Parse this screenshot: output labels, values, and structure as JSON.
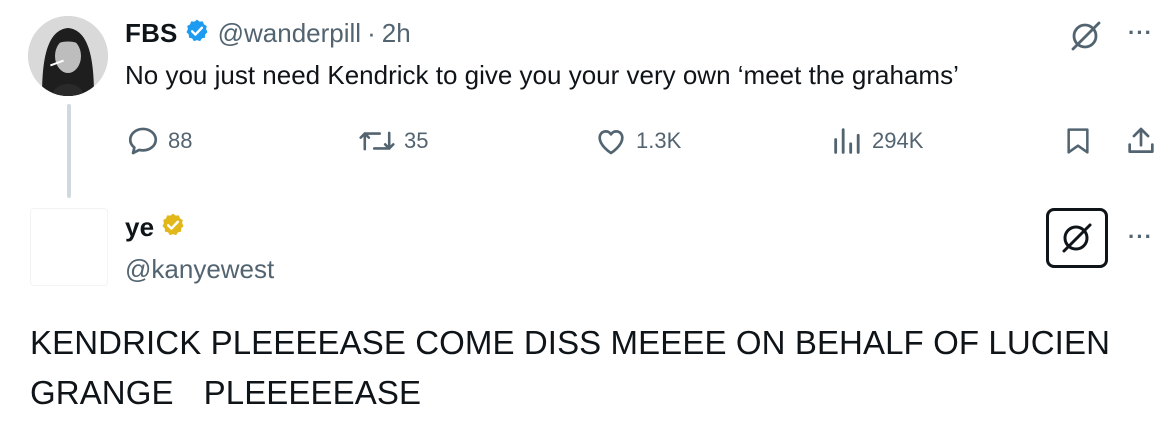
{
  "tweet1": {
    "display_name": "FBS",
    "handle": "@wanderpill",
    "separator": "·",
    "time": "2h",
    "text": "No you just need Kendrick to give you your very own ‘meet the grahams’",
    "stats": {
      "replies": "88",
      "reposts": "35",
      "likes": "1.3K",
      "views": "294K"
    },
    "more_label": "···",
    "verified_color": "#1d9bf0"
  },
  "tweet2": {
    "display_name": "ye",
    "handle": "@kanyewest",
    "text_line1": "KENDRICK PLEEEEASE COME DISS MEEEE ON BEHALF OF LUCIEN",
    "text_line2a": "GRANGE",
    "text_line2b": "PLEEEEEASE",
    "more_label": "···",
    "verified_color": "#e2b719"
  },
  "icons": {
    "reply": "reply-icon",
    "repost": "repost-icon",
    "like": "heart-icon",
    "views": "views-icon",
    "bookmark": "bookmark-icon",
    "share": "share-icon",
    "grok": "grok-icon"
  },
  "colors": {
    "text": "#0f1419",
    "muted": "#536471",
    "thread_line": "#cfd9de"
  }
}
